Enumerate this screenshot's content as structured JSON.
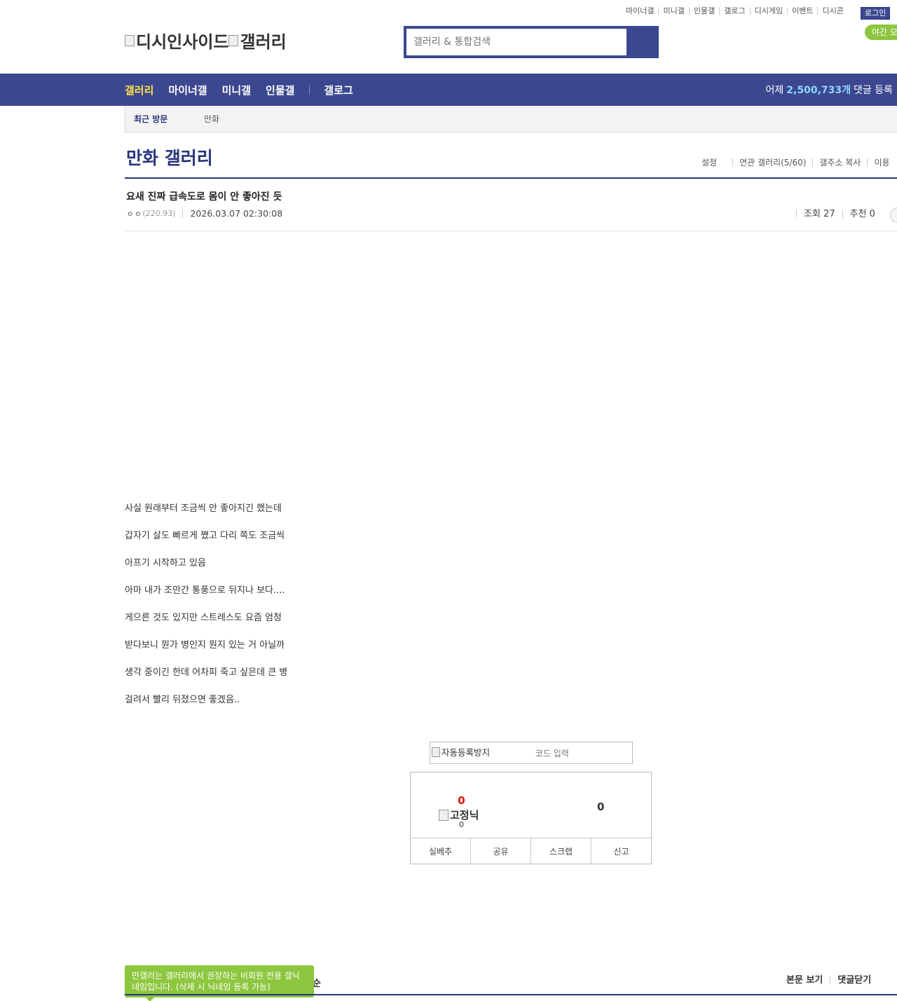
{
  "util_links": [
    "마이너갤",
    "미니갤",
    "인물갤",
    "갤로그",
    "디시게임",
    "이벤트",
    "디시콘"
  ],
  "login_label": "로그인",
  "night_label": "야간 모",
  "logo_text": "디시인사이드",
  "logo_sub": "갤러리",
  "search": {
    "placeholder": "갤러리 & 통합검색"
  },
  "gnb": {
    "items": [
      "갤러리",
      "마이너갤",
      "미니갤",
      "인물갤"
    ],
    "extra": "갤로그",
    "stat_prefix": "어제",
    "stat_value": "2,500,733개",
    "stat_suffix": "댓글 등록"
  },
  "recent": {
    "title": "최근 방문",
    "item": "만화"
  },
  "gallery": {
    "title": "만화 갤러리",
    "options": [
      "설정",
      "연관 갤러리(5/60)",
      "갤주소 복사",
      "이용"
    ]
  },
  "post": {
    "title": "요새 진짜 급속도로 몸이 안 좋아진 듯",
    "nick": "ㅇㅇ",
    "ip": "(220.93)",
    "date": "2026.03.07 02:30:08",
    "views": "조회 27",
    "recommend": "추천 0",
    "lines": [
      "사실 원래부터 조금씩 안 좋아지긴 했는데",
      "갑자기 살도 빠르게 쪘고 다리 쪽도 조금씩",
      "아프기 시작하고 있음",
      "아마 내가 조만간 통풍으로 뒤지나 보다....",
      "게으른 것도 있지만 스트레스도 요즘 엄청",
      "받다보니 뭔가 병인지 뭔지 있는 거 아닐까",
      "생각 중이긴 한데 어차피 죽고 싶은데 큰 병",
      "걸려서 빨리 뒤졌으면 좋겠음.."
    ]
  },
  "captcha": {
    "img_alt": "자동등록방지",
    "placeholder": "코드 입력"
  },
  "recommend_box": {
    "up_count": "0",
    "fixed_label": "고정닉",
    "fixed_count": "0",
    "down_count": "0",
    "buttons": [
      "실베추",
      "공유",
      "스크랩",
      "신고"
    ]
  },
  "tooltip": "만갤러는 갤러리에서 권장하는 비회원 전용 갤닉네임입니다. (삭제 시 닉네임 등록 가능)",
  "behind_text": "순",
  "comment_opts": [
    "본문 보기",
    "댓글닫기"
  ]
}
